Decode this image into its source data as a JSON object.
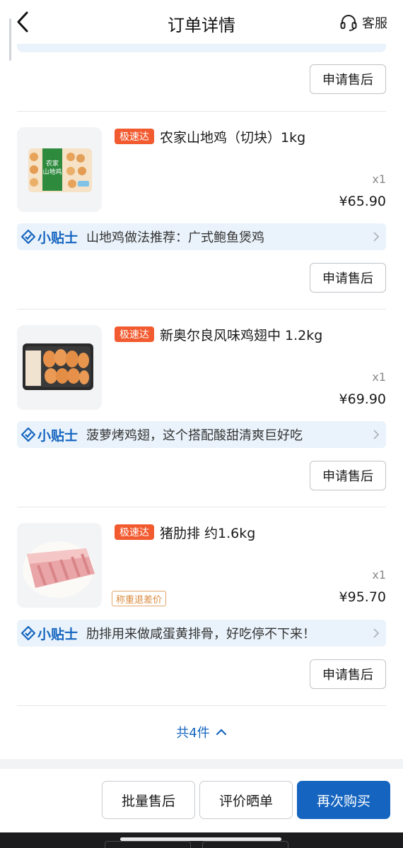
{
  "header": {
    "title": "订单详情",
    "service_label": "客服"
  },
  "products": [
    {
      "badge": "极速达",
      "name": "农家山地鸡（切块）1kg",
      "qty": "x1",
      "price": "¥65.90",
      "image_text": "农家山地鸡",
      "tip": "山地鸡做法推荐：广式鲍鱼煲鸡",
      "after_sale": "申请售后"
    },
    {
      "badge": "极速达",
      "name": "新奥尔良风味鸡翅中 1.2kg",
      "qty": "x1",
      "price": "¥69.90",
      "tip": "菠萝烤鸡翅，这个搭配酸甜清爽巨好吃",
      "after_sale": "申请售后"
    },
    {
      "badge": "极速达",
      "name": "猪肋排 约1.6kg",
      "qty": "x1",
      "price": "¥95.70",
      "weigh_tag": "称重退差价",
      "tip": "肋排用来做咸蛋黄排骨，好吃停不下来！",
      "after_sale": "申请售后"
    }
  ],
  "top_after_sale": "申请售后",
  "tip_logo": "小贴士",
  "total_label": "共4件",
  "bottom_bar": {
    "batch_after_sale": "批量售后",
    "review": "评价晒单",
    "buy_again": "再次购买"
  },
  "colors": {
    "accent": "#1565c0",
    "badge": "#f25a2f",
    "tip_bg": "#eaf3fb"
  }
}
